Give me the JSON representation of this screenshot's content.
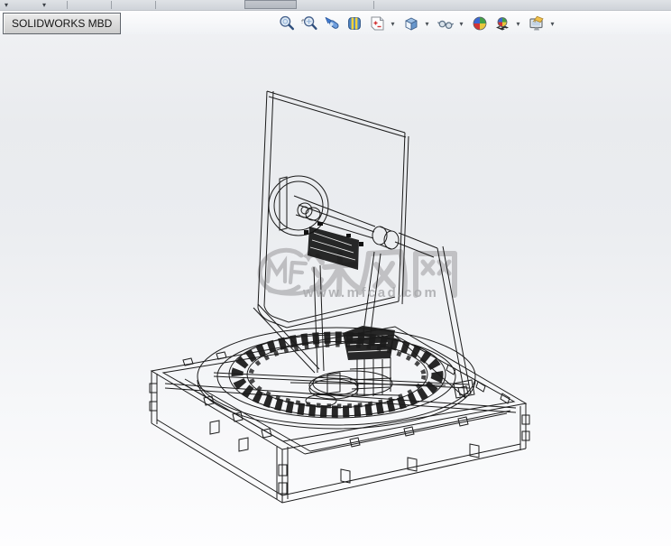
{
  "tab": {
    "label": "SOLIDWORKS MBD"
  },
  "toolbar": {
    "items": [
      {
        "name": "zoom-to-fit",
        "icon": "magnifier-icon",
        "has_dropdown": false
      },
      {
        "name": "zoom-to-area",
        "icon": "magnifier-area-icon",
        "has_dropdown": false
      },
      {
        "name": "previous-view",
        "icon": "arrow-flashlight-icon",
        "has_dropdown": false
      },
      {
        "name": "section-view",
        "icon": "striped-block-icon",
        "has_dropdown": false
      },
      {
        "name": "annotation-views",
        "icon": "annotated-sheet-icon",
        "has_dropdown": true
      },
      {
        "name": "view-orientation",
        "icon": "cube-icon",
        "has_dropdown": true
      },
      {
        "name": "hide-show-items",
        "icon": "glasses-icon",
        "has_dropdown": true
      },
      {
        "name": "edit-appearance",
        "icon": "color-sphere-icon",
        "has_dropdown": false
      },
      {
        "name": "apply-scene",
        "icon": "scene-sphere-icon",
        "has_dropdown": true
      },
      {
        "name": "view-settings",
        "icon": "monitor-pencil-icon",
        "has_dropdown": true
      }
    ]
  },
  "watermark": {
    "logo": "MF",
    "site_name": "沐风网",
    "url": "www.mfcad.com"
  },
  "colors": {
    "strip_bg": "#d4d8dd",
    "tab_bg": "#d6d6d6",
    "canvas_top": "#e9ebee",
    "canvas_bottom": "#fdfdfe",
    "wire_line": "#1b1b1b",
    "watermark_gray": "#b3b3b6",
    "sphere_blue": "#3a66d4",
    "sphere_green": "#43a047",
    "sphere_red": "#d23434",
    "sphere_yellow": "#e9c73d"
  }
}
